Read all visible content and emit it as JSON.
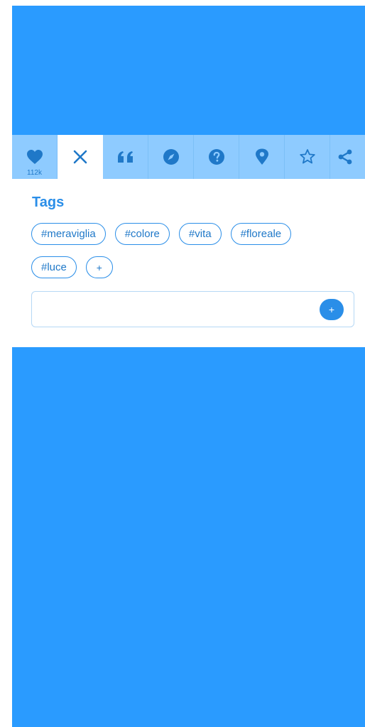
{
  "toolbar": {
    "like_count": "112k",
    "buttons": [
      {
        "icon": "heart-icon"
      },
      {
        "icon": "close-icon"
      },
      {
        "icon": "quote-icon"
      },
      {
        "icon": "compass-icon"
      },
      {
        "icon": "question-icon"
      },
      {
        "icon": "map-pin-icon"
      },
      {
        "icon": "star-icon"
      },
      {
        "icon": "share-icon"
      }
    ]
  },
  "tags": {
    "title": "Tags",
    "items": [
      "#meraviglia",
      "#colore",
      "#vita",
      "#floreale",
      "#luce"
    ],
    "add_chip_label": "+",
    "input_value": "",
    "input_placeholder": "",
    "input_add_label": "+"
  },
  "colors": {
    "accent": "#2a8ee8",
    "hero": "#2a9bff",
    "toolbar_bg": "#8ecbff"
  }
}
